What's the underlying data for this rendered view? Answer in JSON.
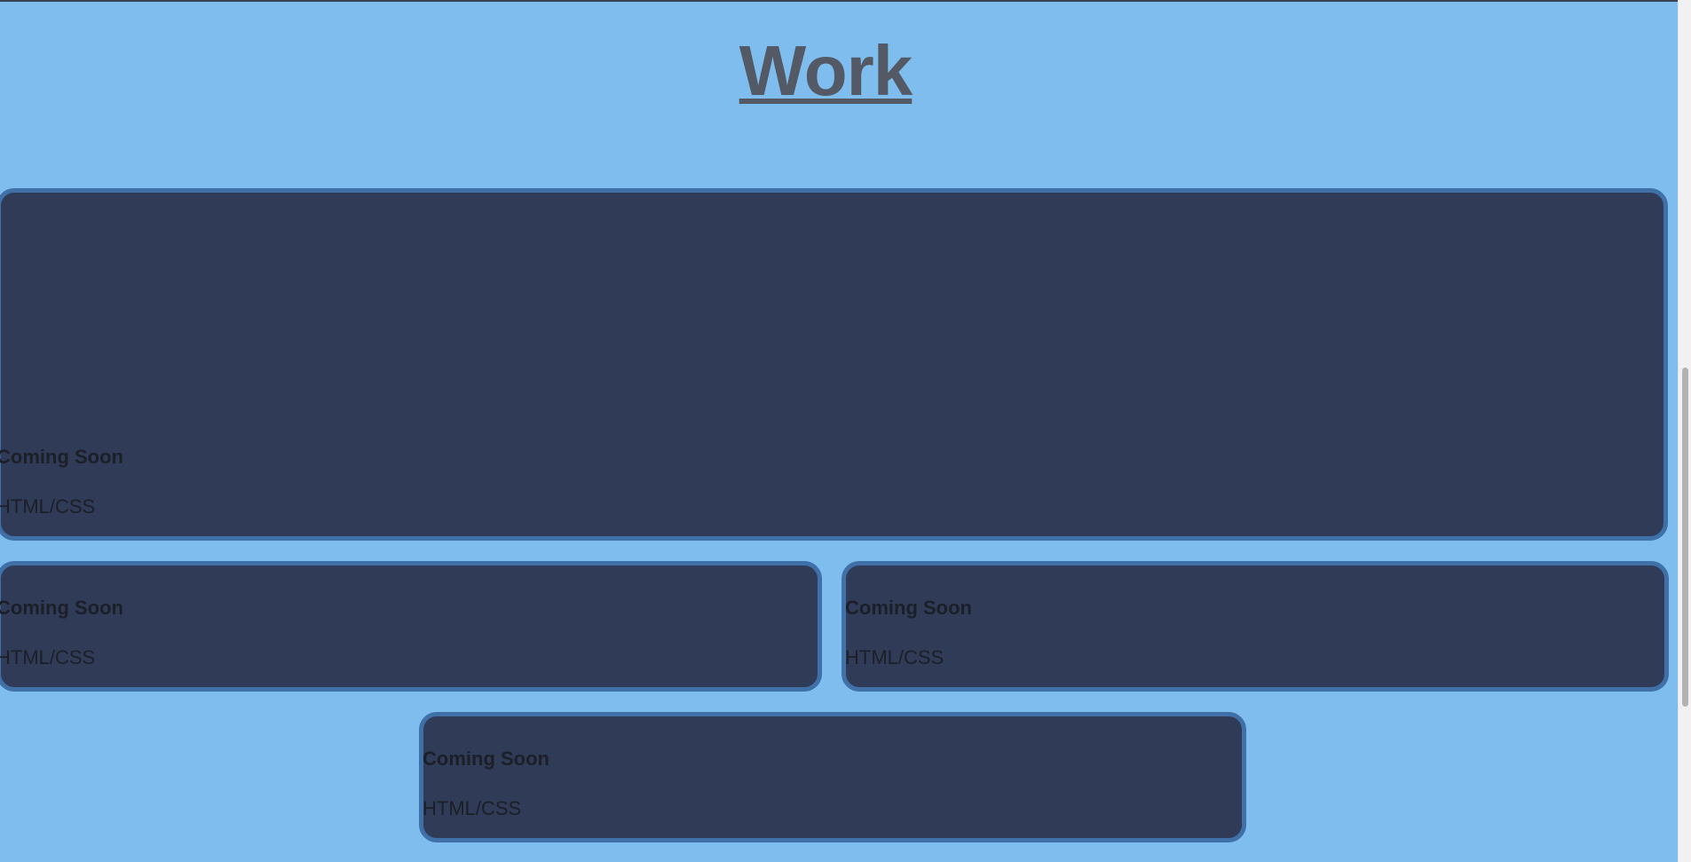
{
  "header": {
    "title": "Work"
  },
  "projects": [
    {
      "name": "Coming Soon",
      "tech": "HTML/CSS"
    },
    {
      "name": "Coming Soon",
      "tech": "HTML/CSS"
    },
    {
      "name": "Coming Soon",
      "tech": "HTML/CSS"
    },
    {
      "name": "Coming Soon",
      "tech": "HTML/CSS"
    }
  ],
  "colors": {
    "background": "#7ebdee",
    "card": "#303b58",
    "card_border": "#3f70a8",
    "title": "#545a65",
    "text": "#1b1f27"
  }
}
